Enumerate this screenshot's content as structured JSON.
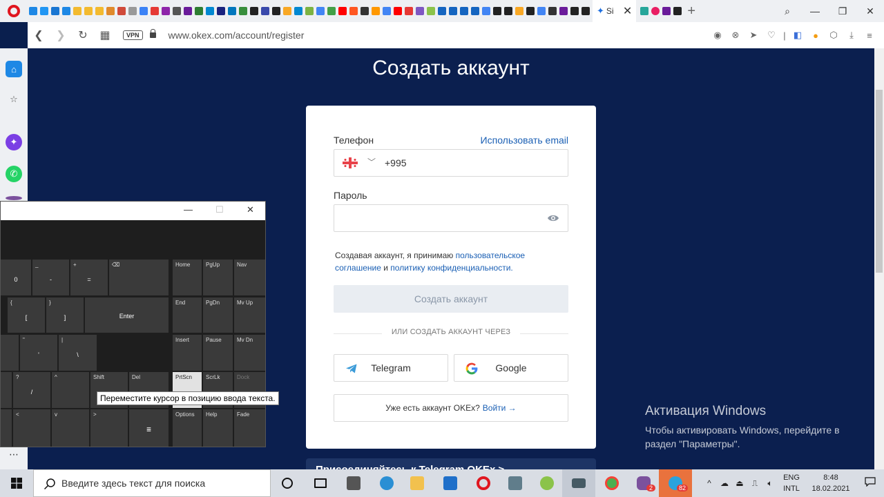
{
  "browser": {
    "active_tab_title": "Si",
    "url": "www.okex.com/account/register",
    "vpn_badge": "VPN",
    "new_tab": "+"
  },
  "page": {
    "title": "Создать аккаунт",
    "phone_label": "Телефон",
    "use_email": "Использовать email",
    "phone_code": "+995",
    "password_label": "Пароль",
    "consent_prefix": "Создавая аккаунт, я принимаю",
    "consent_link1": "пользовательское соглашение",
    "consent_and": "и",
    "consent_link2": "политику конфиденциальности.",
    "submit": "Создать аккаунт",
    "divider": "ИЛИ СОЗДАТЬ АККАУНТ ЧЕРЕЗ",
    "telegram": "Telegram",
    "google": "Google",
    "have_account": "Уже есть аккаунт OKEx?",
    "login": "Войти →",
    "banner": "Присоединяйтесь к Telegram OKEx >"
  },
  "activation": {
    "title": "Активация Windows",
    "line1": "Чтобы активировать Windows, перейдите в",
    "line2": "раздел \"Параметры\"."
  },
  "osk": {
    "tooltip": "Переместите курсор в позицию ввода текста.",
    "keys": {
      "zero": "0",
      "underscore": "_",
      "minus": "-",
      "plus": "+",
      "equals": "=",
      "backspace": "⌫",
      "home": "Home",
      "pgup": "PgUp",
      "nav": "Nav",
      "brace_open": "{",
      "bracket_open": "[",
      "brace_close": "}",
      "bracket_close": "]",
      "enter": "Enter",
      "end": "End",
      "pgdn": "PgDn",
      "mvup": "Mv Up",
      "quote_top": "\"",
      "quote": "'",
      "pipe": "|",
      "backslash": "\\",
      "insert": "Insert",
      "pause": "Pause",
      "mvdn": "Mv Dn",
      "question": "?",
      "slash": "/",
      "up": "^",
      "shift": "Shift",
      "del": "Del",
      "prtscn": "PrtScn",
      "scrlk": "ScrLk",
      "dock": "Dock",
      "left": "<",
      "down": "v",
      "right": ">",
      "menu": "≣",
      "options": "Options",
      "help": "Help",
      "fade": "Fade"
    }
  },
  "taskbar": {
    "search_placeholder": "Введите здесь текст для поиска",
    "lang_line1": "ENG",
    "lang_line2": "INTL",
    "time": "8:48",
    "date": "18.02.2021",
    "viber_badge": "2",
    "telegram_badge": "82"
  }
}
